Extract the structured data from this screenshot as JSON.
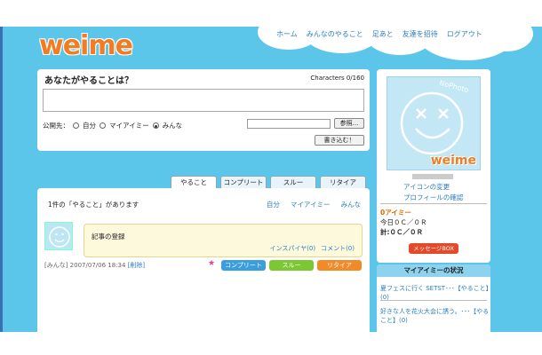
{
  "logo": "weime",
  "nav": [
    "ホーム",
    "みんなのやること",
    "足あと",
    "友達を招待",
    "ログアウト"
  ],
  "post": {
    "title": "あなたがやることは？",
    "chars_label": "Characters 0/160",
    "scope_label": "公開先：",
    "scope_options": [
      "自分",
      "マイアイミー",
      "みんな"
    ],
    "browse_label": "参照...",
    "submit_label": "書き込む！"
  },
  "tabs": [
    "やること",
    "コンプリート",
    "スルー",
    "リタイア"
  ],
  "list": {
    "count_text": "1件の「やること」があります",
    "filters": [
      "自分",
      "マイアイミー",
      "みんな"
    ],
    "item": {
      "text": "記事の登録",
      "links": [
        "インスパイヤ(0)",
        "コメント(0)"
      ],
      "meta": "[みんな] 2007/07/06 18:34",
      "delete_label": "[削除]",
      "star": "★",
      "buttons": [
        "コンプリート",
        "スルー",
        "リタイア"
      ]
    }
  },
  "profile": {
    "avatar_text": "weime",
    "avatar_caption": "NoPhoto",
    "link_icon_change": "アイコンの変更",
    "link_profile": "プロフィールの確認",
    "aimy_count": "0アイミー",
    "today": "今日０Ｃ／０Ｒ",
    "total": "計:０Ｃ／０Ｒ",
    "message_button": "メッセージBOX"
  },
  "status": {
    "title": "マイアイミーの状況",
    "items": [
      "夏フェスに行く SETST･･･【やること】(0)",
      "好きな人を花火大会に誘う。･･･【やること】(0)"
    ]
  }
}
